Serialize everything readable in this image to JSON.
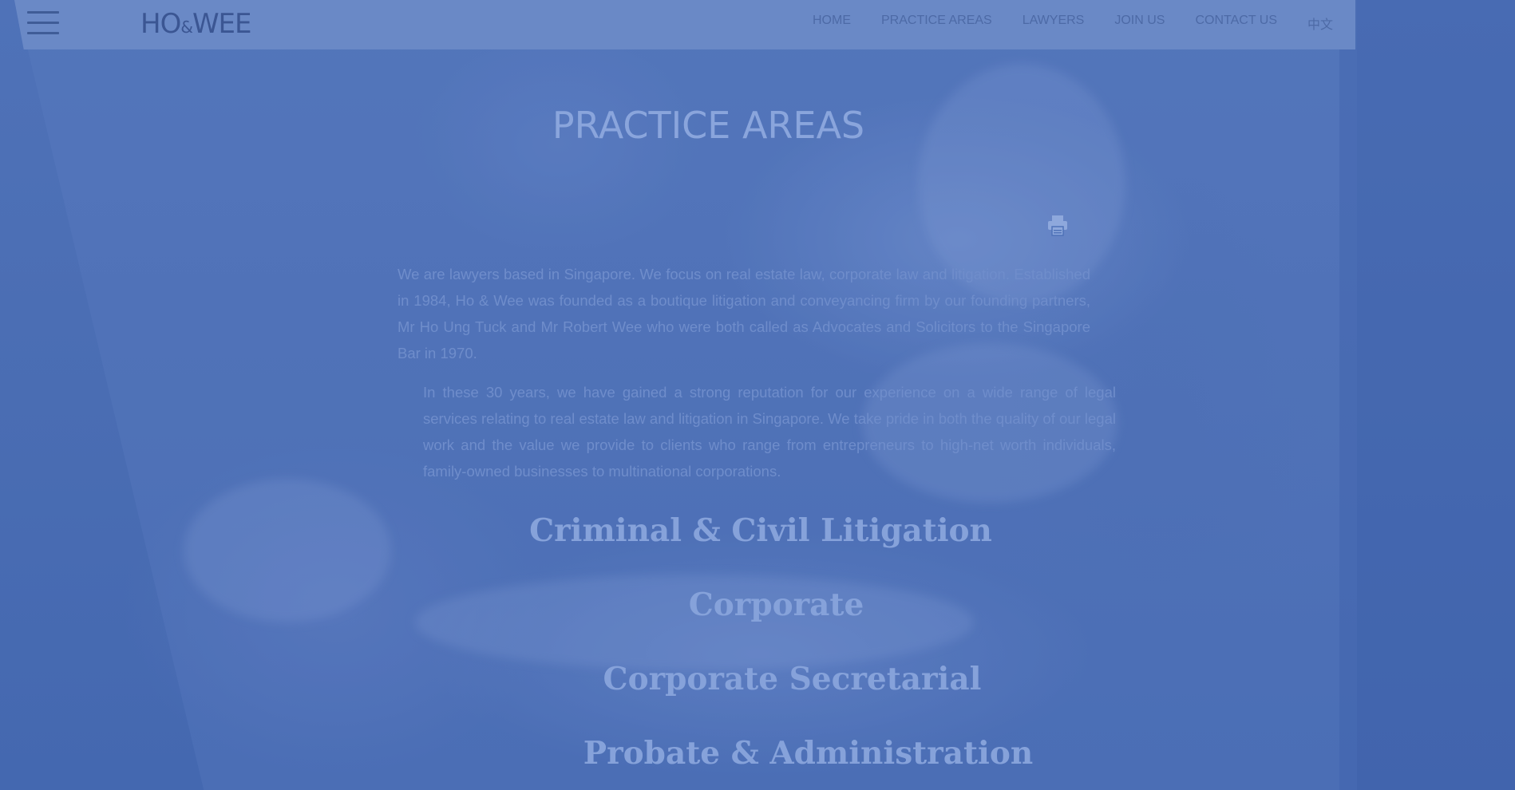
{
  "header": {
    "menu_icon": "hamburger-menu-icon",
    "logo": {
      "left": "HO",
      "amp": "&",
      "right": "WEE"
    },
    "nav": [
      {
        "label": "HOME"
      },
      {
        "label": "PRACTICE AREAS"
      },
      {
        "label": "LAWYERS"
      },
      {
        "label": "JOIN US"
      },
      {
        "label": "CONTACT US"
      },
      {
        "label": "中文"
      }
    ]
  },
  "main": {
    "title": "PRACTICE AREAS",
    "print_icon": "printer-icon",
    "paragraphs": [
      "We are lawyers based in Singapore. We focus on real estate law, corporate law and litigation. Established in 1984, Ho & Wee was founded as a boutique litigation and conveyancing firm by our founding partners, Mr Ho Ung Tuck and Mr Robert Wee who were both called as Advocates and Solicitors to the Singapore Bar in 1970.",
      "In these 30 years, we have gained a strong reputation for our experience on a wide range of legal services relating to real estate law and litigation in Singapore. We take pride in both the quality of our legal work and the value we provide to clients who range from entrepreneurs to high-net worth individuals, family-owned businesses to multinational corporations."
    ],
    "practice_areas": [
      {
        "label": "Criminal & Civil Litigation"
      },
      {
        "label": "Corporate"
      },
      {
        "label": "Corporate Secretarial"
      },
      {
        "label": "Probate & Administration"
      }
    ]
  },
  "colors": {
    "overlay": "#4a6eb4",
    "header_bar": "#6a89c6",
    "nav_text": "#4d6aa6",
    "title_text": "#8aa5dc"
  }
}
